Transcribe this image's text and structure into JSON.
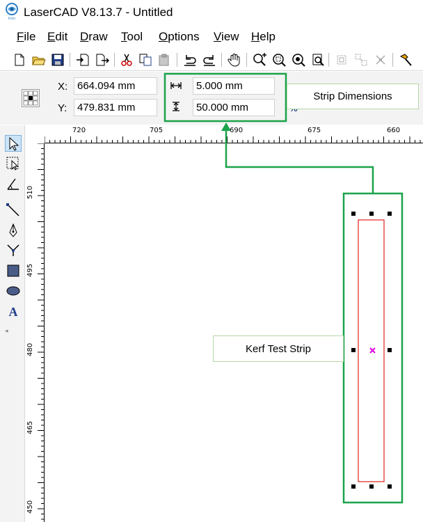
{
  "window": {
    "title": "LaserCAD V8.13.7 - Untitled",
    "app_icon": "lasercad-logo-icon"
  },
  "menu": [
    {
      "label_acc": "F",
      "label_rest": "ile"
    },
    {
      "label_acc": "E",
      "label_rest": "dit"
    },
    {
      "label_acc": "D",
      "label_rest": "raw"
    },
    {
      "label_acc": "T",
      "label_rest": "ool"
    },
    {
      "label_acc": "O",
      "label_rest": "ptions"
    },
    {
      "label_acc": "V",
      "label_rest": "iew"
    },
    {
      "label_acc": "H",
      "label_rest": "elp"
    }
  ],
  "toolbar_icons": [
    "new-file-icon",
    "open-folder-icon",
    "save-icon",
    "import-icon",
    "export-icon",
    "cut-icon",
    "copy-icon",
    "paste-icon",
    "undo-icon",
    "redo-icon",
    "pan-hand-icon",
    "zoom-in-icon",
    "zoom-window-icon",
    "zoom-all-icon",
    "zoom-page-icon",
    "group-icon",
    "ungroup-icon",
    "delete-node-icon",
    "settings-hammer-icon"
  ],
  "properties": {
    "x_label": "X:",
    "x_value": "664.094 mm",
    "y_label": "Y:",
    "y_value": "479.831 mm",
    "width_value": "5.000 mm",
    "height_value": "50.000 mm",
    "percent_hint": "%"
  },
  "tools": [
    "select-arrow-icon",
    "node-select-icon",
    "angle-tool-icon",
    "line-tool-icon",
    "pen-tool-icon",
    "polyline-tool-icon",
    "rectangle-tool-icon",
    "ellipse-tool-icon",
    "text-tool-icon"
  ],
  "ruler": {
    "h_labels": [
      "720",
      "705",
      "690",
      "675",
      "660"
    ],
    "v_labels": [
      "510",
      "495",
      "480",
      "465",
      "450"
    ]
  },
  "callouts": {
    "strip_dimensions": "Strip Dimensions",
    "kerf_test_strip": "Kerf Test Strip"
  },
  "colors": {
    "annotation_green": "#1aa34a",
    "shape_red": "#e02020",
    "center_magenta": "#e000e0",
    "selection_blue": "#cce4f7"
  }
}
